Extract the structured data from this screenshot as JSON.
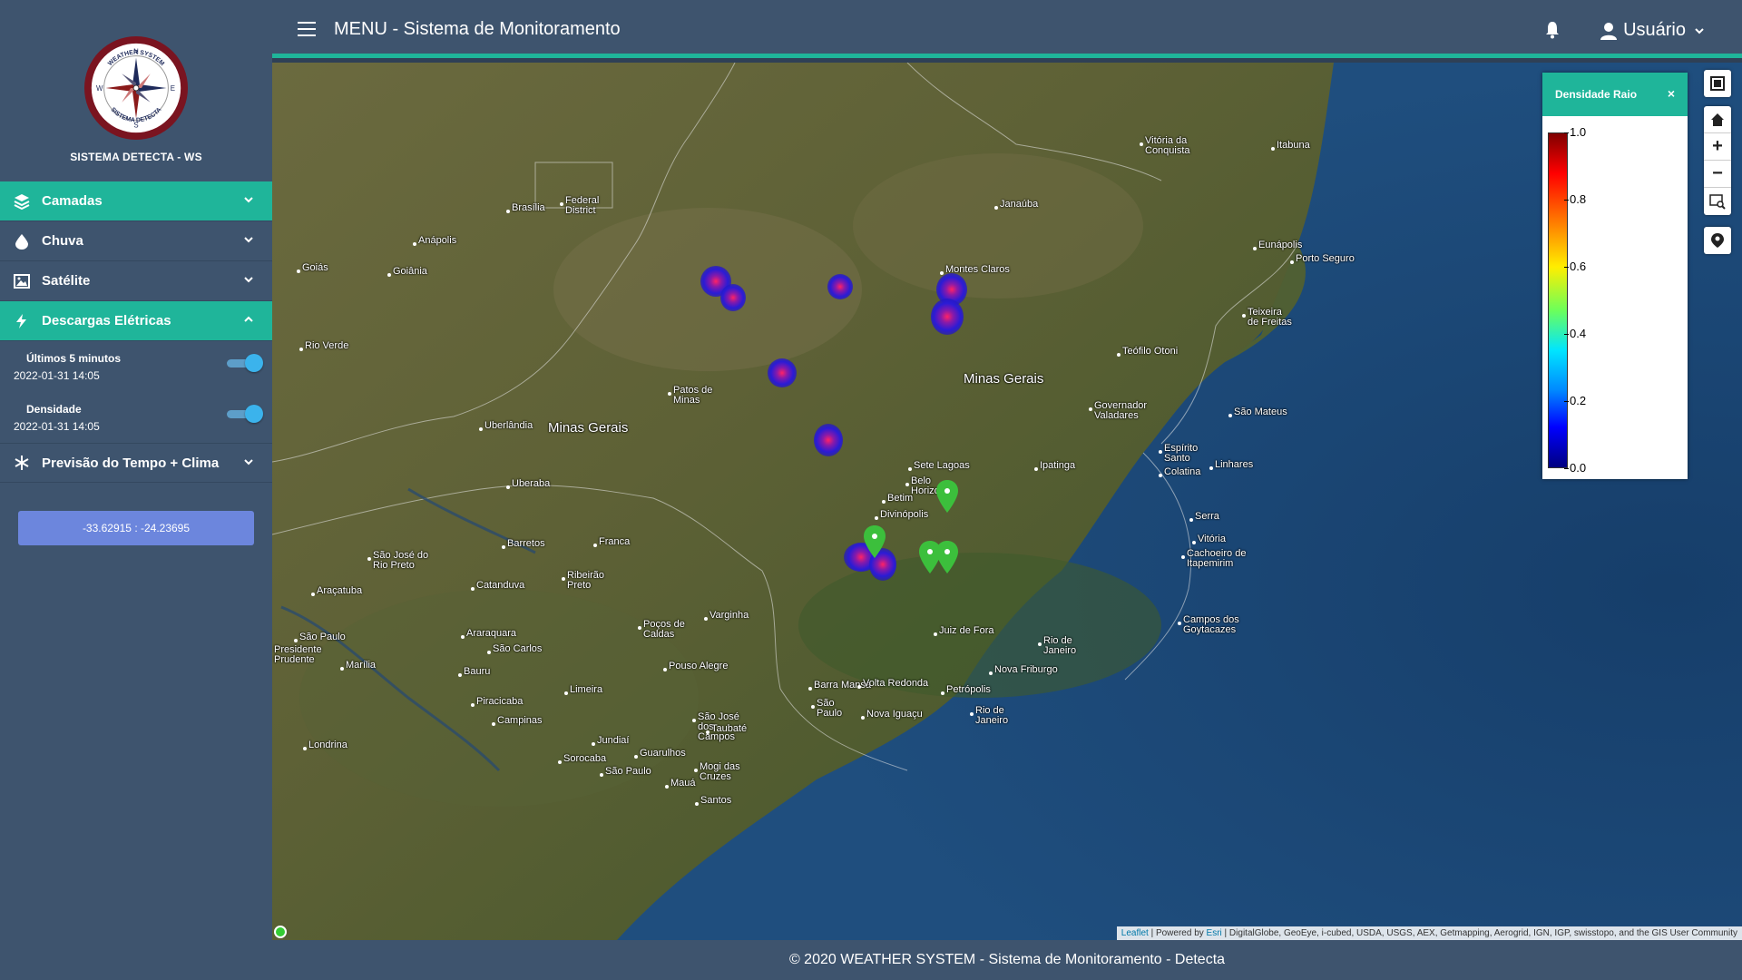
{
  "sidebar": {
    "logo_text": "SISTEMA DETECTA - WS",
    "logo_ring_top": "WEATHER SYSTEM",
    "logo_ring_bottom": "SISTEMA DETECTA",
    "logo_letters": [
      "N",
      "E",
      "S",
      "W"
    ],
    "items": [
      {
        "label": "Camadas",
        "icon": "layers-icon"
      },
      {
        "label": "Chuva",
        "icon": "droplet-icon"
      },
      {
        "label": "Satélite",
        "icon": "image-icon"
      },
      {
        "label": "Descargas Elétricas",
        "icon": "lightning-icon"
      },
      {
        "label": "Previsão do Tempo + Clima",
        "icon": "snowflake-icon"
      }
    ],
    "sub_items": [
      {
        "label": "Últimos 5 minutos",
        "date": "2022-01-31 14:05",
        "enabled": true
      },
      {
        "label": "Densidade",
        "date": "2022-01-31 14:05",
        "enabled": true
      }
    ],
    "coords": "-33.62915 : -24.23695"
  },
  "header": {
    "title": "MENU - Sistema de Monitoramento",
    "user_label": "Usuário"
  },
  "map": {
    "places": [
      {
        "name": "Vitória da\nConquista"
      },
      {
        "name": "Itabuna"
      },
      {
        "name": "Brasília"
      },
      {
        "name": "Federal\nDistrict"
      },
      {
        "name": "Janaúba"
      },
      {
        "name": "Anápolis"
      },
      {
        "name": "Goiás"
      },
      {
        "name": "Goiânia"
      },
      {
        "name": "Eunápolis"
      },
      {
        "name": "Porto Seguro"
      },
      {
        "name": "Montes Claros"
      },
      {
        "name": "Teixeira\nde Freitas"
      },
      {
        "name": "Rio Verde"
      },
      {
        "name": "Teófilo Otoni"
      },
      {
        "name": "Minas Gerais"
      },
      {
        "name": "Patos de\nMinas"
      },
      {
        "name": "Governador\nValadares"
      },
      {
        "name": "São Mateus"
      },
      {
        "name": "Uberlândia"
      },
      {
        "name": "Minas Gerais"
      },
      {
        "name": "Sete Lagoas"
      },
      {
        "name": "Ipatinga"
      },
      {
        "name": "Espírito\nSanto"
      },
      {
        "name": "Colatina"
      },
      {
        "name": "Linhares"
      },
      {
        "name": "Uberaba"
      },
      {
        "name": "Belo\nHorizonte"
      },
      {
        "name": "Betim"
      },
      {
        "name": "Divinópolis"
      },
      {
        "name": "Serra"
      },
      {
        "name": "Vitória"
      },
      {
        "name": "Franca"
      },
      {
        "name": "Barretos"
      },
      {
        "name": "São José do\nRio Preto"
      },
      {
        "name": "Ribeirão\nPreto"
      },
      {
        "name": "Cachoeiro de\nItapemirim"
      },
      {
        "name": "Araçatuba"
      },
      {
        "name": "Catanduva"
      },
      {
        "name": "Varginha"
      },
      {
        "name": "Campos dos\nGoytacazes"
      },
      {
        "name": "São Paulo"
      },
      {
        "name": "Araraquara"
      },
      {
        "name": "Poços de\nCaldas"
      },
      {
        "name": "Juiz de Fora"
      },
      {
        "name": "Presidente\nPrudente"
      },
      {
        "name": "São Carlos"
      },
      {
        "name": "Rio de\nJaneiro"
      },
      {
        "name": "Marília"
      },
      {
        "name": "Bauru"
      },
      {
        "name": "Pouso Alegre"
      },
      {
        "name": "Nova Friburgo"
      },
      {
        "name": "Barra Mansa"
      },
      {
        "name": "Volta Redonda"
      },
      {
        "name": "Petrópolis"
      },
      {
        "name": "Limeira"
      },
      {
        "name": "Piracicaba"
      },
      {
        "name": "São\nPaulo"
      },
      {
        "name": "Nova Iguaçu"
      },
      {
        "name": "Rio de\nJaneiro"
      },
      {
        "name": "São José\ndos\nCampos"
      },
      {
        "name": "Campinas"
      },
      {
        "name": "Taubaté"
      },
      {
        "name": "Jundiaí"
      },
      {
        "name": "Londrina"
      },
      {
        "name": "Guarulhos"
      },
      {
        "name": "Sorocaba"
      },
      {
        "name": "Mogi das\nCruzes"
      },
      {
        "name": "São Paulo"
      },
      {
        "name": "Mauá"
      },
      {
        "name": "Santos"
      }
    ],
    "legend": {
      "title": "Densidade Raio",
      "close": "×",
      "ticks": [
        "1.0",
        "0.8",
        "0.6",
        "0.4",
        "0.2",
        "0.0"
      ]
    },
    "controls": {
      "zoom_in": "+",
      "zoom_out": "−"
    },
    "attribution": {
      "leaflet": "Leaflet",
      "powered": " | Powered by ",
      "esri": "Esri",
      "sources": " | DigitalGlobe, GeoEye, i-cubed, USDA, USGS, AEX, Getmapping, Aerogrid, IGN, IGP, swisstopo, and the GIS User Community"
    }
  },
  "footer": {
    "text": "© 2020 WEATHER SYSTEM - Sistema de Monitoramento - Detecta"
  },
  "colors": {
    "sidebar": "#3e546e",
    "accent": "#1fb59a",
    "button": "#6c86dd",
    "toggle": "#3bb3ec",
    "marker": "#3cbf3c"
  }
}
